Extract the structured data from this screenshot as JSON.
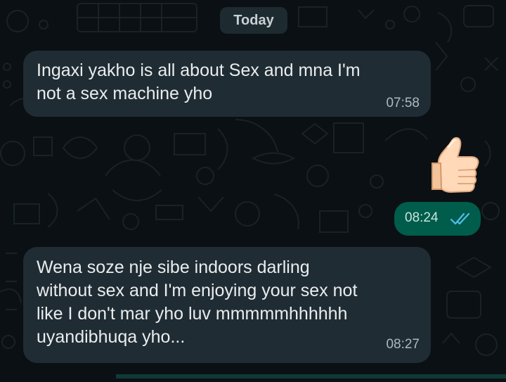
{
  "date_separator": "Today",
  "messages": [
    {
      "direction": "incoming",
      "text": "Ingaxi yakho is all about Sex and mna I'm\nnot a sex machine yho",
      "time": "07:58"
    },
    {
      "direction": "outgoing",
      "emoji": "thumbs-up-icon",
      "time": "08:24",
      "status": "read-ticks-icon"
    },
    {
      "direction": "incoming",
      "text": "Wena soze nje sibe indoors darling\nwithout sex and I'm enjoying your sex not\nlike I don't mar yho luv mmmmmhhhhhh\nuyandibhuqa yho...",
      "time": "08:27"
    }
  ],
  "colors": {
    "incoming_bubble": "#202c33",
    "outgoing_bubble": "#005c4b",
    "read_ticks": "#53bdeb",
    "background": "#0b1014"
  }
}
